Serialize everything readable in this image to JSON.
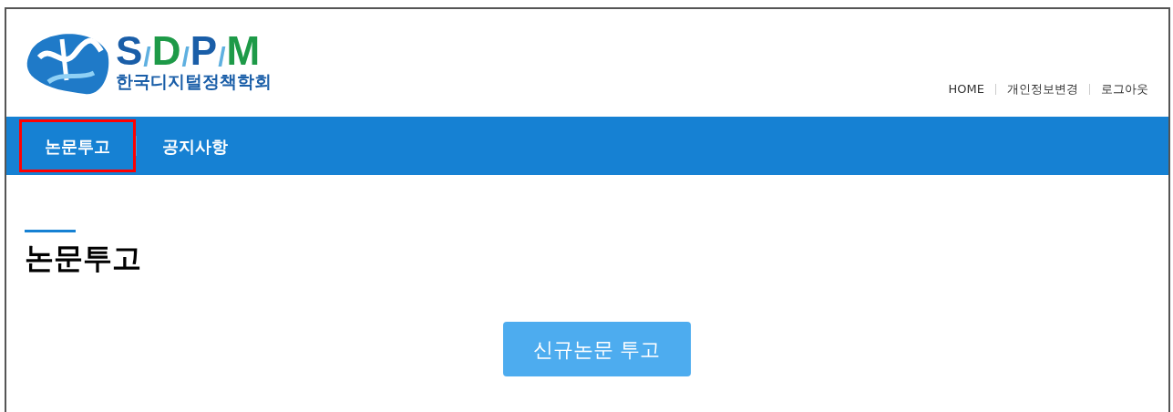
{
  "logo": {
    "letters": [
      {
        "text": "S",
        "color": "#1a5ea8"
      },
      {
        "text": "/",
        "color": "#5fb0e0"
      },
      {
        "text": "D",
        "color": "#1e9a48"
      },
      {
        "text": "/",
        "color": "#5fb0e0"
      },
      {
        "text": "P",
        "color": "#1a5ea8"
      },
      {
        "text": "/",
        "color": "#5fb0e0"
      },
      {
        "text": "M",
        "color": "#1e9a48"
      }
    ],
    "subtitle": "한국디지털정책학회"
  },
  "top_links": [
    "HOME",
    "개인정보변경",
    "로그아웃"
  ],
  "nav": [
    {
      "label": "논문투고",
      "selected": true
    },
    {
      "label": "공지사항",
      "selected": false
    }
  ],
  "page_title": "논문투고",
  "primary_button": "신규논문 투고"
}
